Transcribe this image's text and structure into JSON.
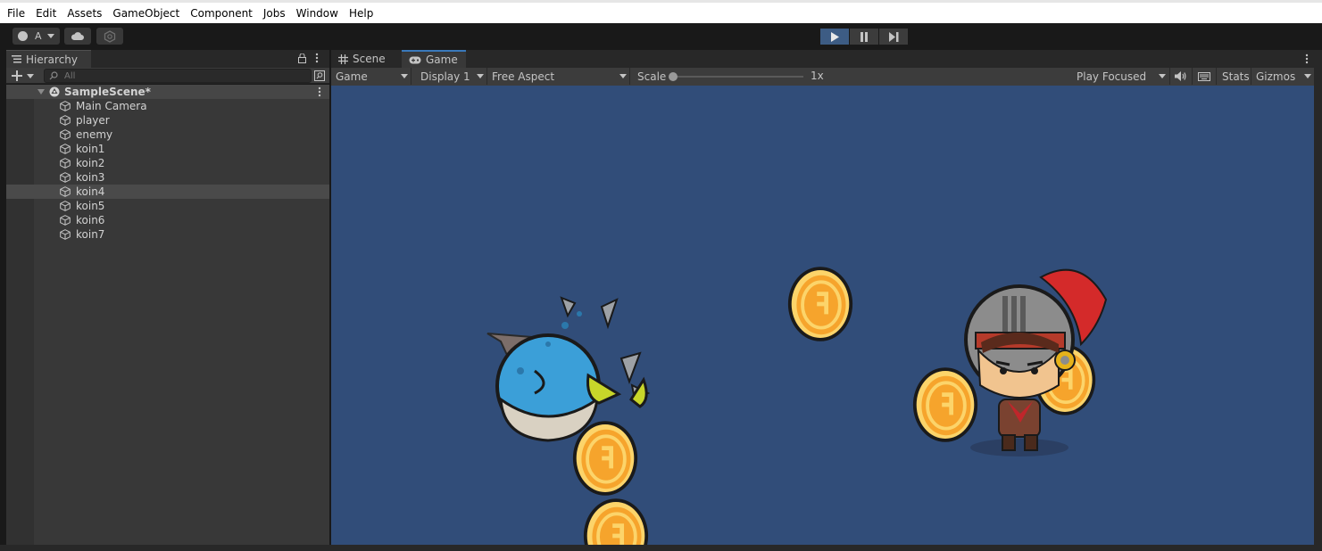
{
  "menu": [
    "File",
    "Edit",
    "Assets",
    "GameObject",
    "Component",
    "Jobs",
    "Window",
    "Help"
  ],
  "toolbar": {
    "account_label": "A",
    "account_icon": "account-icon",
    "cloud_icon": "cloud-icon",
    "collab_icon": "collab-icon",
    "play_icon": "play-icon",
    "pause_icon": "pause-icon",
    "step_icon": "step-icon"
  },
  "hierarchy": {
    "tab_label": "Hierarchy",
    "search_placeholder": "All",
    "scene_name": "SampleScene*",
    "items": [
      "Main Camera",
      "player",
      "enemy",
      "koin1",
      "koin2",
      "koin3",
      "koin4",
      "koin5",
      "koin6",
      "koin7"
    ],
    "selected": "koin4"
  },
  "game_view": {
    "tabs": [
      "Scene",
      "Game"
    ],
    "active_tab": "Game",
    "view_select": "Game",
    "display_select": "Display 1",
    "aspect_select": "Free Aspect",
    "scale_label": "Scale",
    "scale_value": "1x",
    "play_mode_select": "Play Focused",
    "stats_label": "Stats",
    "gizmos_label": "Gizmos",
    "background_color": "#314d79"
  },
  "colors": {
    "accent": "#3a79bb",
    "play_active": "#3d5c84",
    "coin": "#f6a42c",
    "enemy_body": "#3b9fd8",
    "knight_plume": "#d42a2a"
  }
}
